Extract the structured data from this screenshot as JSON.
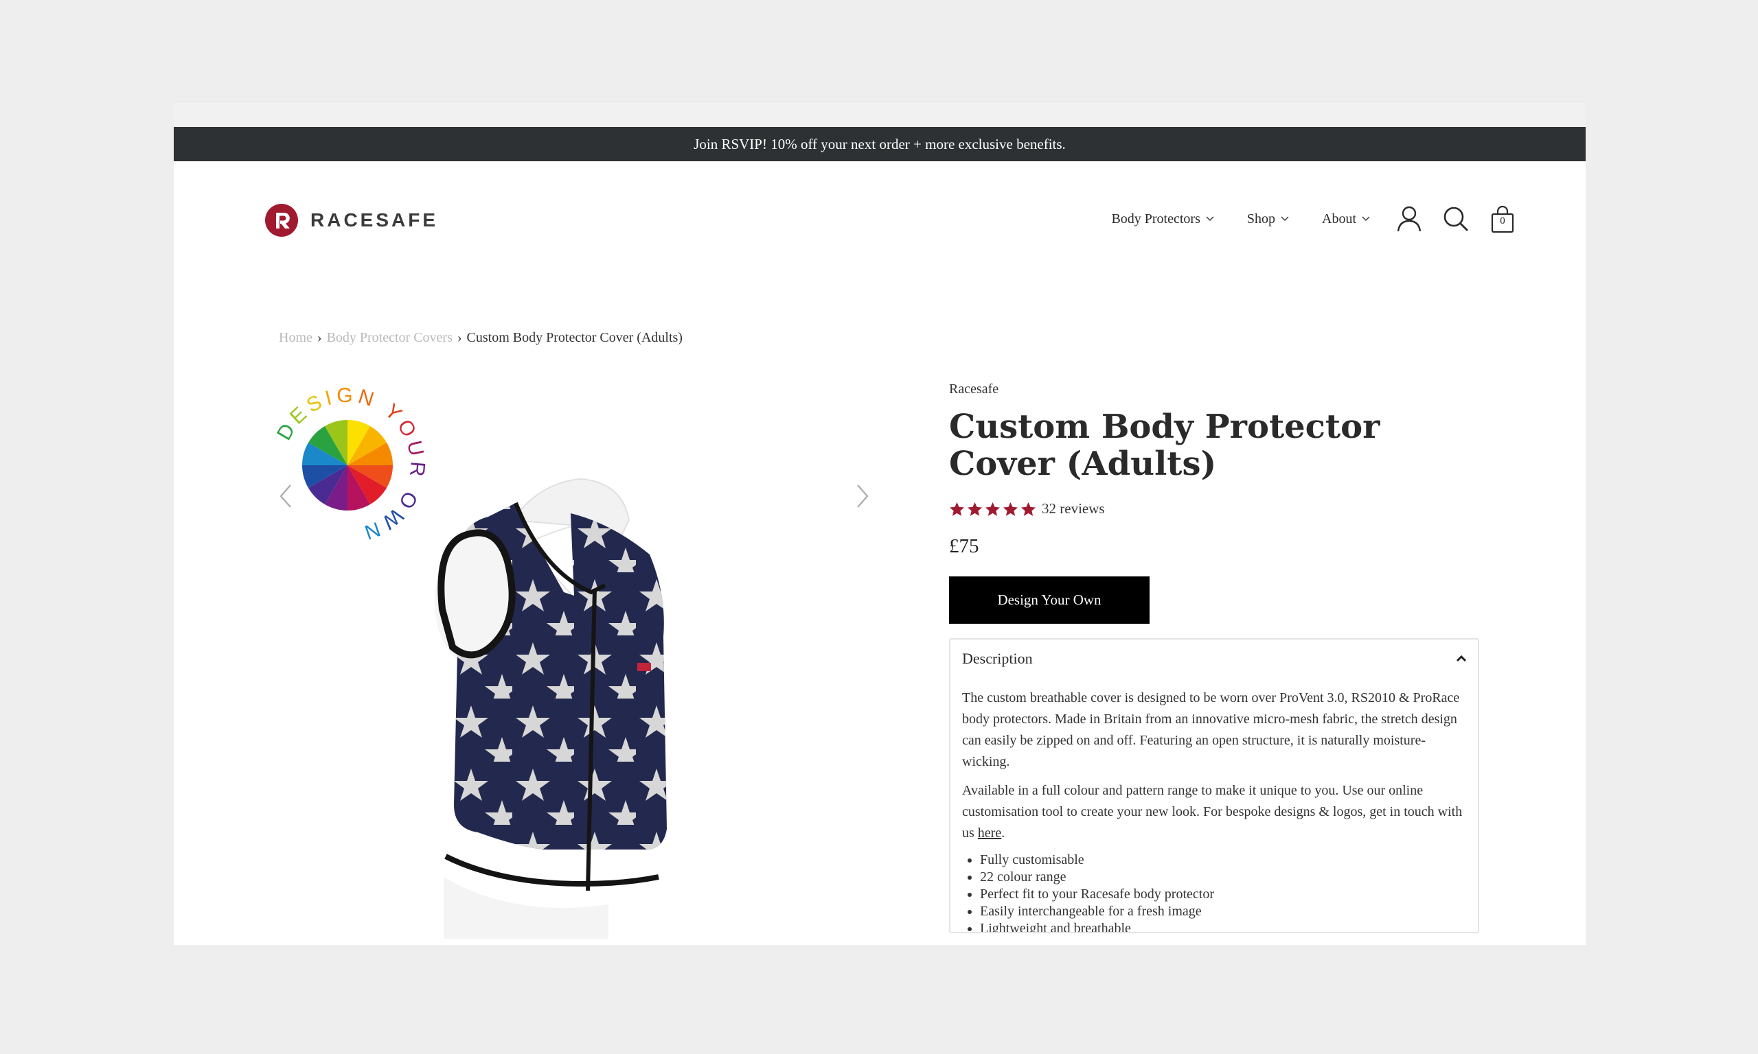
{
  "announcement": {
    "text": "Join RSVIP! 10% off your next order + more exclusive benefits."
  },
  "brand": {
    "name": "RACESAFE",
    "accent": "#a01a30"
  },
  "nav": {
    "items": [
      {
        "label": "Body Protectors"
      },
      {
        "label": "Shop"
      },
      {
        "label": "About"
      }
    ],
    "cart_count": "0"
  },
  "breadcrumb": {
    "items": [
      "Home",
      "Body Protector Covers",
      "Custom Body Protector Cover (Adults)"
    ],
    "separator": "›"
  },
  "gallery": {
    "badge_text": "DESIGN YOUR OWN",
    "prev_icon": "chevron-left-icon",
    "next_icon": "chevron-right-icon"
  },
  "product": {
    "vendor": "Racesafe",
    "title": "Custom Body Protector Cover (Adults)",
    "rating": 5,
    "reviews": "32 reviews",
    "price": "£75",
    "cta": "Design Your Own",
    "star_color": "#a01a30"
  },
  "description": {
    "heading": "Description",
    "para1": "The custom breathable cover is designed to be worn over ProVent 3.0, RS2010 & ProRace body protectors.  Made in Britain from an innovative micro-mesh fabric, the stretch design can easily be zipped on and off.  Featuring an open structure, it is naturally moisture-wicking.",
    "para2_before": "Available in a full colour and pattern range to make it unique to you.  Use our online customisation tool to create your new look. For bespoke designs & logos, get in touch with us ",
    "para2_link": "here",
    "para2_after": ".",
    "features": [
      "Fully customisable",
      "22 colour range",
      "Perfect fit to your Racesafe body protector",
      "Easily interchangeable for a fresh image",
      "Lightweight and breathable"
    ]
  }
}
